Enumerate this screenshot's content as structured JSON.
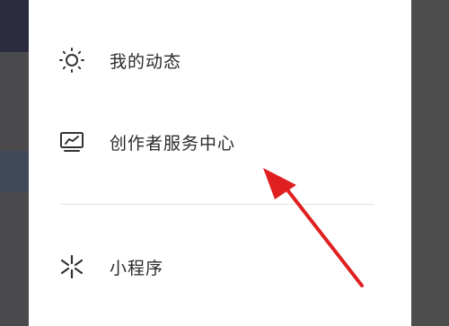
{
  "menu": {
    "items": [
      {
        "label": "我的动态",
        "icon": "sun-icon"
      },
      {
        "label": "创作者服务中心",
        "icon": "chart-monitor-icon"
      },
      {
        "label": "小程序",
        "icon": "mini-program-icon"
      }
    ]
  },
  "colors": {
    "annotation_arrow": "#e02020",
    "side_overlay": "#4d4d4d",
    "divider": "#e3e3e3"
  }
}
